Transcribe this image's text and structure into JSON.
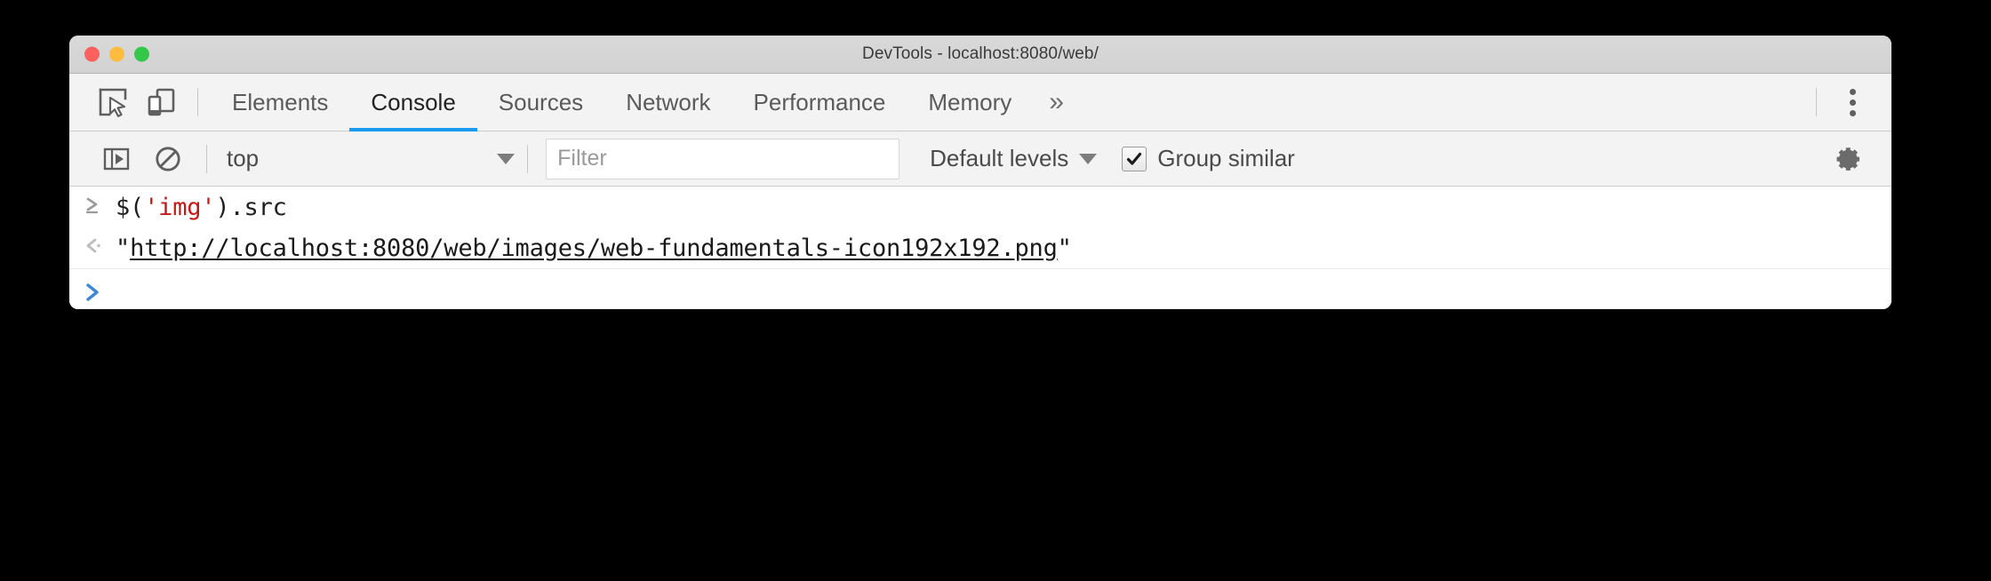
{
  "window": {
    "title": "DevTools - localhost:8080/web/",
    "traffic_lights": {
      "close_color": "#fc615d",
      "minimize_color": "#fdbc40",
      "maximize_color": "#34c84a"
    }
  },
  "tabbar": {
    "inspect_icon": "inspect-element-icon",
    "device_icon": "device-toolbar-icon",
    "tabs": [
      {
        "label": "Elements",
        "active": false
      },
      {
        "label": "Console",
        "active": true
      },
      {
        "label": "Sources",
        "active": false
      },
      {
        "label": "Network",
        "active": false
      },
      {
        "label": "Performance",
        "active": false
      },
      {
        "label": "Memory",
        "active": false
      }
    ],
    "overflow_label": "»",
    "more_options_icon": "kebab-menu-icon",
    "active_tab_color": "#1a9bf0"
  },
  "console_toolbar": {
    "sidebar_toggle_icon": "console-sidebar-icon",
    "clear_icon": "clear-console-icon",
    "context": {
      "value": "top",
      "caret": "▼"
    },
    "filter": {
      "value": "",
      "placeholder": "Filter"
    },
    "levels": {
      "label": "Default levels",
      "caret": "▼"
    },
    "group_similar": {
      "label": "Group similar",
      "checked": true
    },
    "settings_icon": "gear-icon"
  },
  "console": {
    "rows": [
      {
        "type": "input",
        "marker": "〉",
        "segments": [
          {
            "text": "$(",
            "kind": "plain"
          },
          {
            "text": "'img'",
            "kind": "string"
          },
          {
            "text": ").src",
            "kind": "plain"
          }
        ],
        "plain_text": "$('img').src"
      },
      {
        "type": "result",
        "marker": "‹",
        "quote_open": "\"",
        "url": "http://localhost:8080/web/images/web-fundamentals-icon192x192.png",
        "quote_close": "\"",
        "plain_text": "\"http://localhost:8080/web/images/web-fundamentals-icon192x192.png\""
      }
    ],
    "prompt": {
      "marker": "›",
      "value": "",
      "color": "#3b87d8"
    },
    "string_token_color": "#c41a16"
  }
}
